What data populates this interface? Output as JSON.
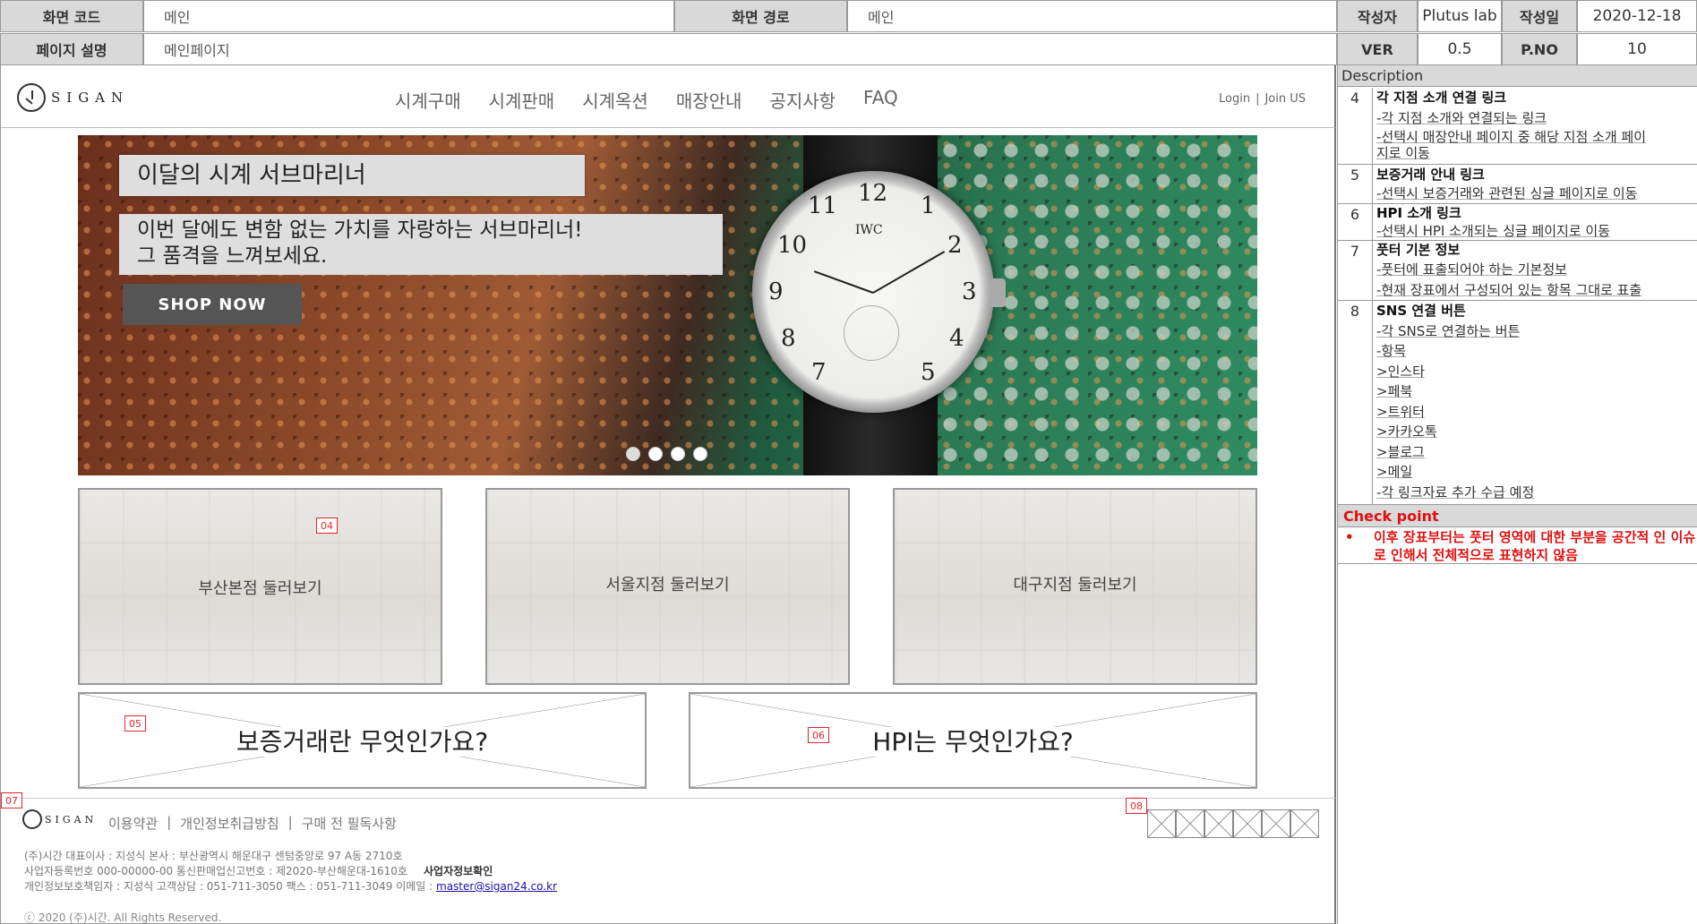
{
  "meta": {
    "screen_code_label": "화면 코드",
    "screen_code_value": "메인",
    "screen_path_label": "화면 경로",
    "screen_path_value": "메인",
    "author_label": "작성자",
    "author_value": "Plutus lab",
    "date_label": "작성일",
    "date_value": "2020-12-18",
    "page_desc_label": "페이지 설명",
    "page_desc_value": "메인페이지",
    "ver_label": "VER",
    "ver_value": "0.5",
    "pno_label": "P.NO",
    "pno_value": "10"
  },
  "site": {
    "logo_text": "SIGAN",
    "menu": [
      "시계구매",
      "시계판매",
      "시계옥션",
      "매장안내",
      "공지사항",
      "FAQ"
    ],
    "login": "Login",
    "separator": "|",
    "join": "Join US"
  },
  "hero": {
    "title": "이달의 시계 서브마리너",
    "desc_line1": "이번 달에도 변함 없는 가치를 자랑하는 서브마리너!",
    "desc_line2": "그 품격을 느껴보세요.",
    "cta": "SHOP NOW",
    "watch_brand": "IWC",
    "numerals": [
      "12",
      "11",
      "1",
      "10",
      "2",
      "9",
      "3",
      "8",
      "4",
      "7",
      "5"
    ]
  },
  "branches": [
    {
      "label": "부산본점 둘러보기"
    },
    {
      "label": "서울지점 둘러보기"
    },
    {
      "label": "대구지점 둘러보기"
    }
  ],
  "tags": {
    "t04": "04",
    "t05": "05",
    "t06": "06",
    "t07": "07",
    "t08": "08"
  },
  "promo": {
    "guarantee": "보증거래란 무엇인가요?",
    "hpi": "HPI는 무엇인가요?"
  },
  "footer": {
    "logo_text": "SIGAN",
    "links": [
      "이용약관",
      "|",
      "개인정보취급방침",
      "|",
      "구매 전 필독사항"
    ],
    "info_line1": "(주)시간  대표이사 : 지성식     본사 : 부산광역시 해운대구 센텀중앙로 97 A동 2710호",
    "info_line2": "사업자등록번호  000-00000-00  통신판매업신고번호 : 제2020-부산해운대-1610호",
    "biz_check": "사업자정보확인",
    "info_line3": "개인정보보호책임자 : 지성식  고객상담 : 051-711-3050  팩스  : 051-711-3049  이메일 :",
    "email": "master@sigan24.co.kr",
    "copyright": "ⓒ 2020 (주)시간. All Rights Reserved."
  },
  "description": {
    "header": "Description",
    "items": [
      {
        "no": "4",
        "title": "각 지점 소개 연결 링크",
        "lines": [
          "-각 지점 소개와 연결되는 링크",
          "-선택시 매장안내 페이지 중 해당 지점 소개 페이",
          "지로 이동"
        ]
      },
      {
        "no": "5",
        "title": "보증거래 안내 링크",
        "lines": [
          "-선택시 보증거래와 관련된 싱글 페이지로 이동"
        ]
      },
      {
        "no": "6",
        "title": "HPI 소개 링크",
        "lines": [
          "-선택시 HPI 소개되는 싱글 페이지로 이동"
        ]
      },
      {
        "no": "7",
        "title": "풋터 기본 정보",
        "lines": [
          "-풋터에 표출되어야 하는 기본정보",
          "-현재 장표에서 구성되어 있는 항목 그대로 표출"
        ]
      },
      {
        "no": "8",
        "title": "SNS 연결 버튼",
        "lines": [
          "-각 SNS로 연결하는 버튼",
          "-항목",
          ">인스타",
          ">페북",
          ">트위터",
          ">카카오톡",
          ">블로그",
          ">메일",
          "-각 링크자료 추가 수급 예정"
        ]
      }
    ],
    "checkpoint_header": "Check point",
    "checkpoint_text": "이후 장표부터는 풋터 영역에 대한 부분을 공간적 인 이슈로 인해서 전체적으로 표현하지 않음"
  }
}
